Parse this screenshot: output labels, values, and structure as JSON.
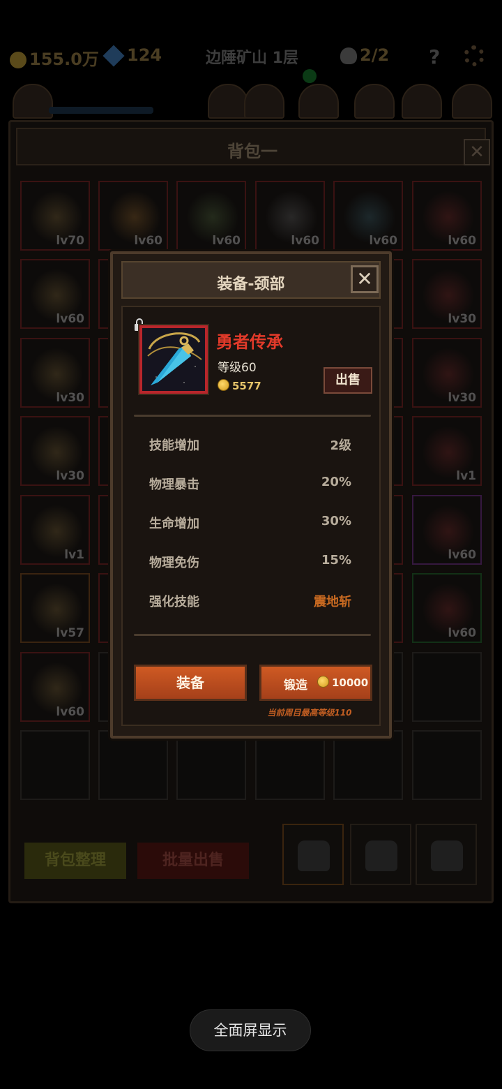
{
  "hud": {
    "gold": "155.0万",
    "gems": "124",
    "location": "边陲矿山 1层",
    "skull_count": "2/2",
    "help": "?"
  },
  "backpack": {
    "title": "背包一",
    "close": "✕",
    "slot_levels": [
      "lv70",
      "lv60",
      "lv60",
      "lv60",
      "lv60",
      "lv60",
      "lv60",
      "",
      "",
      "",
      "",
      "lv30",
      "lv30",
      "",
      "",
      "",
      "",
      "lv30",
      "lv30",
      "",
      "",
      "",
      "",
      "lv1",
      "lv1",
      "",
      "",
      "",
      "",
      "lv60",
      "lv57",
      "",
      "",
      "",
      "",
      "lv60",
      "lv60",
      "",
      "",
      "",
      "",
      "",
      "",
      "",
      "",
      "",
      "",
      ""
    ],
    "sort_button": "背包整理",
    "bulk_sell_button": "批量出售"
  },
  "modal": {
    "title": "装备-颈部",
    "close": "✕",
    "item": {
      "name": "勇者传承",
      "level": "等级60",
      "price": "5577",
      "sell_button": "出售"
    },
    "stats": [
      {
        "label": "技能增加",
        "value": "2级"
      },
      {
        "label": "物理暴击",
        "value": "20%"
      },
      {
        "label": "生命增加",
        "value": "30%"
      },
      {
        "label": "物理免伤",
        "value": "15%"
      },
      {
        "label": "强化技能",
        "value": "震地斩"
      }
    ],
    "equip_button": "装备",
    "forge_button": "锻造",
    "forge_cost": "10000",
    "forge_note": "当前周目最高等级110"
  },
  "colors": {
    "item_name": "#e23a2a",
    "skill_highlight": "#c96a21",
    "button": "#c1501f"
  },
  "fullscreen_button": "全面屏显示"
}
